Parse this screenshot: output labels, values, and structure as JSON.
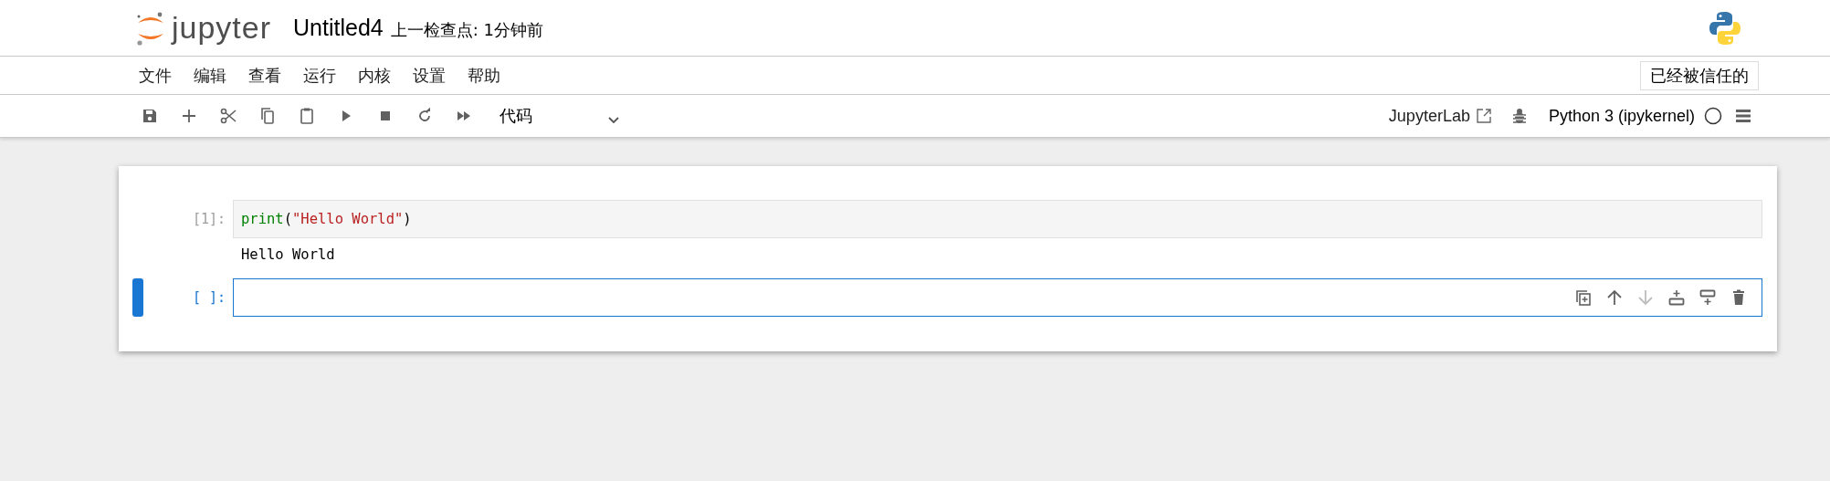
{
  "header": {
    "logo_text": "jupyter",
    "notebook_name": "Untitled4",
    "checkpoint": "上一检查点: 1分钟前"
  },
  "menu": {
    "items": [
      "文件",
      "编辑",
      "查看",
      "运行",
      "内核",
      "设置",
      "帮助"
    ],
    "trusted": "已经被信任的"
  },
  "toolbar": {
    "buttons": [
      {
        "kind": "save"
      },
      {
        "kind": "add"
      },
      {
        "kind": "cut"
      },
      {
        "kind": "copy"
      },
      {
        "kind": "paste"
      },
      {
        "kind": "run"
      },
      {
        "kind": "stop"
      },
      {
        "kind": "restart"
      },
      {
        "kind": "run-all"
      }
    ],
    "cell_type": "代码",
    "jupyterlab_link": "JupyterLab",
    "kernel_name": "Python 3 (ipykernel)"
  },
  "cells": [
    {
      "prompt": "[1]:",
      "selected": false,
      "code": [
        {
          "text": "print",
          "kind": "builtin"
        },
        {
          "text": "(",
          "kind": "plain"
        },
        {
          "text": "\"Hello World\"",
          "kind": "string"
        },
        {
          "text": ")",
          "kind": "plain"
        }
      ],
      "output": "Hello World"
    },
    {
      "prompt": "[ ]:",
      "selected": true,
      "actions": [
        {
          "kind": "duplicate",
          "disabled": false
        },
        {
          "kind": "move-up",
          "disabled": false
        },
        {
          "kind": "move-down",
          "disabled": true
        },
        {
          "kind": "insert-above",
          "disabled": false
        },
        {
          "kind": "insert-below",
          "disabled": false
        },
        {
          "kind": "delete",
          "disabled": false
        }
      ]
    }
  ]
}
